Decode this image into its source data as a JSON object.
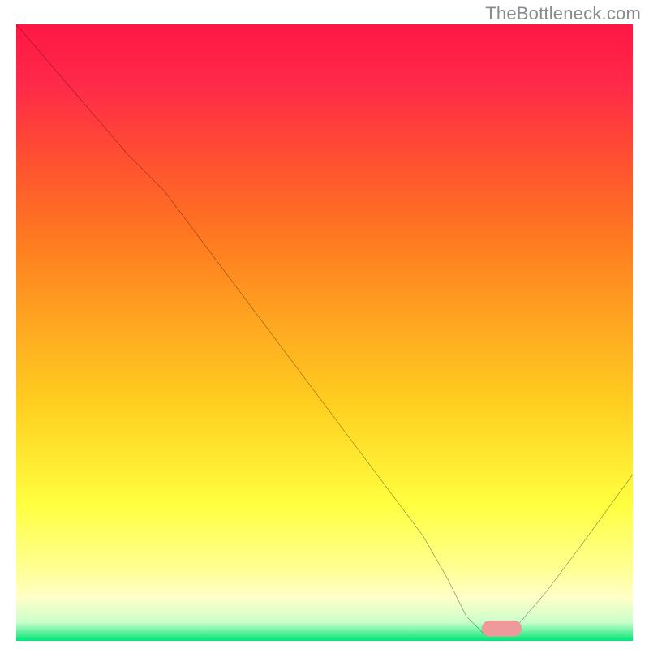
{
  "watermark": "TheBottleneck.com",
  "chart_data": {
    "type": "line",
    "title": "",
    "xlabel": "",
    "ylabel": "",
    "xlim": [
      0,
      100
    ],
    "ylim": [
      0,
      100
    ],
    "grid": false,
    "background": {
      "type": "vertical-gradient",
      "stops": [
        {
          "pos": 0.0,
          "color": "#ff1744"
        },
        {
          "pos": 0.1,
          "color": "#ff2a49"
        },
        {
          "pos": 0.22,
          "color": "#ff5030"
        },
        {
          "pos": 0.35,
          "color": "#ff7a20"
        },
        {
          "pos": 0.48,
          "color": "#ffa520"
        },
        {
          "pos": 0.62,
          "color": "#ffd020"
        },
        {
          "pos": 0.78,
          "color": "#ffff40"
        },
        {
          "pos": 0.88,
          "color": "#ffff90"
        },
        {
          "pos": 0.93,
          "color": "#ffffc8"
        },
        {
          "pos": 0.97,
          "color": "#caffca"
        },
        {
          "pos": 1.0,
          "color": "#00e676"
        }
      ]
    },
    "series": [
      {
        "name": "bottleneck-curve",
        "color": "#000000",
        "x": [
          0,
          6,
          12,
          18,
          22,
          24,
          30,
          36,
          42,
          48,
          54,
          60,
          66,
          70,
          73,
          76,
          80,
          86,
          92,
          100
        ],
        "y": [
          100,
          93,
          86,
          79,
          75,
          73,
          65,
          57,
          49,
          41,
          33,
          25,
          17,
          10,
          4,
          1,
          1,
          8,
          16,
          27
        ]
      }
    ],
    "marker": {
      "name": "optimal-range",
      "shape": "rounded-bar",
      "color": "#ef9a9a",
      "x_start": 75.5,
      "x_end": 82,
      "y": 2,
      "height": 2.6
    }
  }
}
